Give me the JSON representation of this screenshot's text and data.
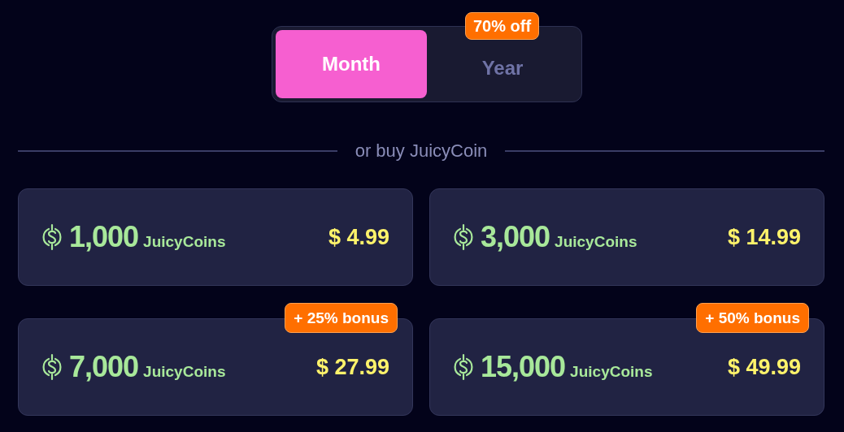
{
  "billing_toggle": {
    "tabs": [
      {
        "label": "Month",
        "selected": true
      },
      {
        "label": "Year",
        "selected": false,
        "badge": "70% off"
      }
    ]
  },
  "divider_label": "or buy JuicyCoin",
  "packages": [
    {
      "amount": "1,000",
      "unit": "JuicyCoins",
      "price": "$ 4.99"
    },
    {
      "amount": "3,000",
      "unit": "JuicyCoins",
      "price": "$ 14.99"
    },
    {
      "amount": "7,000",
      "unit": "JuicyCoins",
      "price": "$ 27.99",
      "badge": "+ 25% bonus"
    },
    {
      "amount": "15,000",
      "unit": "JuicyCoins",
      "price": "$ 49.99",
      "badge": "+ 50% bonus"
    }
  ]
}
